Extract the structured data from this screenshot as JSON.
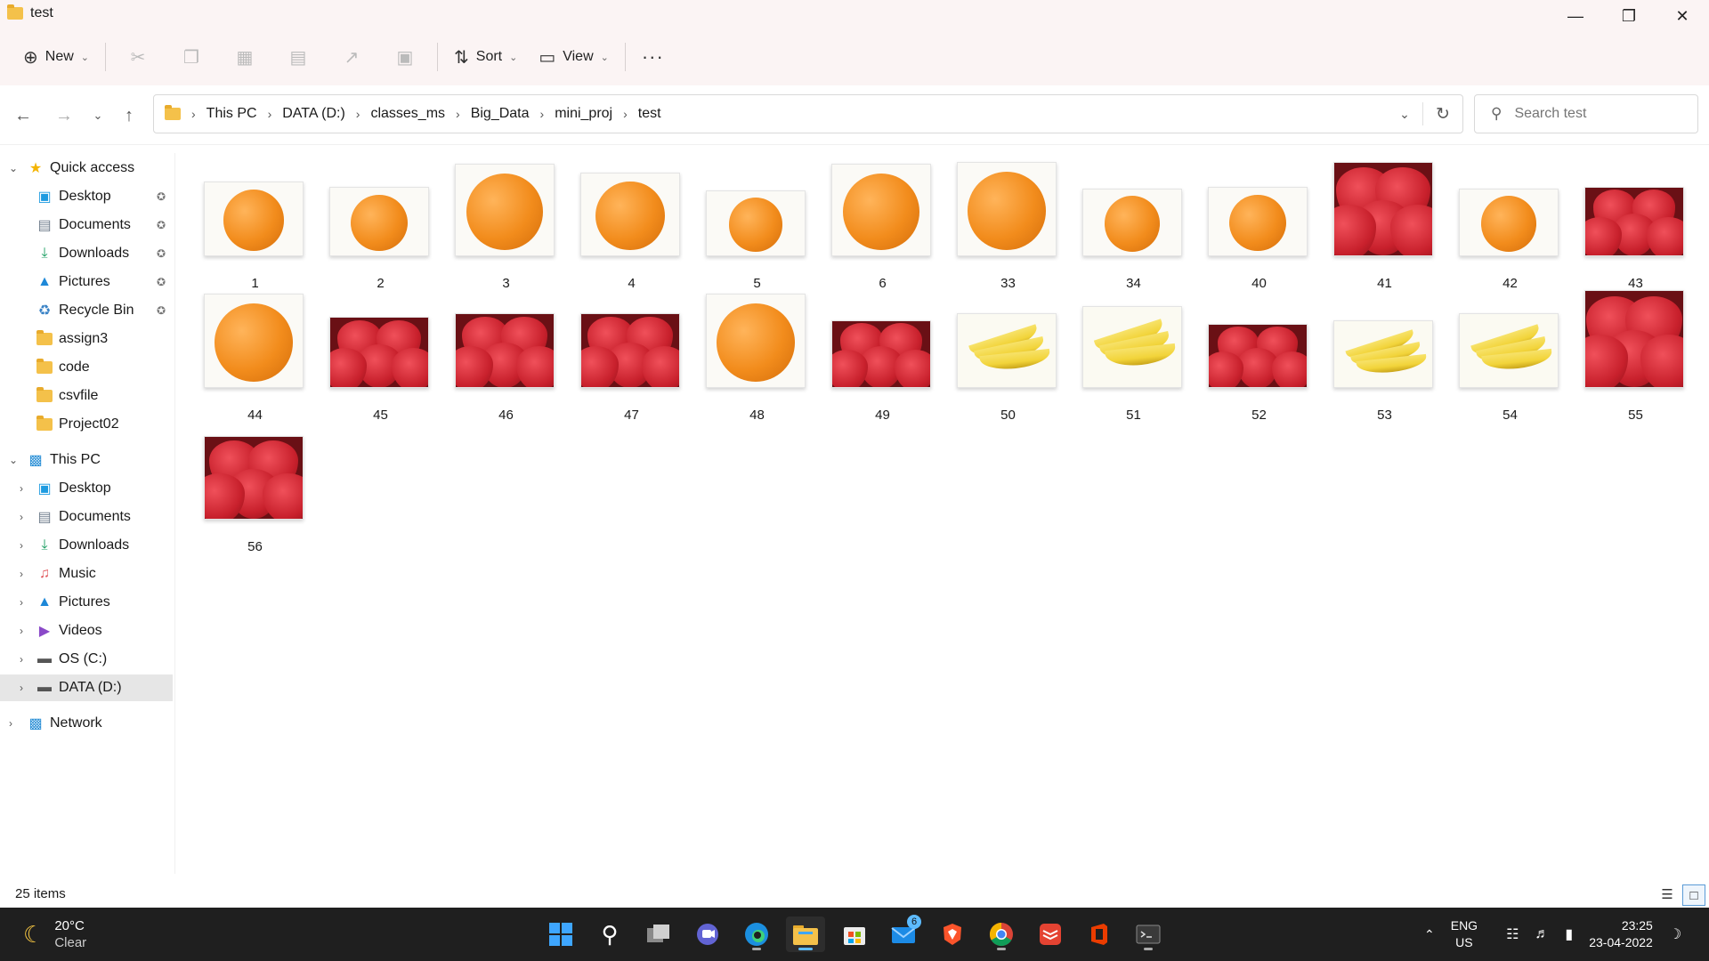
{
  "window": {
    "title": "test"
  },
  "toolbar": {
    "new_label": "New",
    "sort_label": "Sort",
    "view_label": "View"
  },
  "address": {
    "crumbs": [
      "This PC",
      "DATA (D:)",
      "classes_ms",
      "Big_Data",
      "mini_proj",
      "test"
    ]
  },
  "search": {
    "placeholder": "Search test"
  },
  "sidebar": {
    "quick_access": "Quick access",
    "quick_items": [
      "Desktop",
      "Documents",
      "Downloads",
      "Pictures",
      "Recycle Bin",
      "assign3",
      "code",
      "csvfile",
      "Project02"
    ],
    "this_pc": "This PC",
    "pc_items": [
      "Desktop",
      "Documents",
      "Downloads",
      "Music",
      "Pictures",
      "Videos",
      "OS (C:)",
      "DATA (D:)"
    ],
    "network": "Network"
  },
  "files": [
    {
      "name": "1",
      "fruit": "orange"
    },
    {
      "name": "2",
      "fruit": "orange"
    },
    {
      "name": "3",
      "fruit": "orange"
    },
    {
      "name": "4",
      "fruit": "orange"
    },
    {
      "name": "5",
      "fruit": "orange"
    },
    {
      "name": "6",
      "fruit": "orange"
    },
    {
      "name": "33",
      "fruit": "orange"
    },
    {
      "name": "34",
      "fruit": "orange"
    },
    {
      "name": "40",
      "fruit": "orange"
    },
    {
      "name": "41",
      "fruit": "strawberry"
    },
    {
      "name": "42",
      "fruit": "orange"
    },
    {
      "name": "43",
      "fruit": "strawberry"
    },
    {
      "name": "44",
      "fruit": "orange"
    },
    {
      "name": "45",
      "fruit": "strawberry"
    },
    {
      "name": "46",
      "fruit": "strawberry"
    },
    {
      "name": "47",
      "fruit": "strawberry"
    },
    {
      "name": "48",
      "fruit": "orange"
    },
    {
      "name": "49",
      "fruit": "strawberry"
    },
    {
      "name": "50",
      "fruit": "banana"
    },
    {
      "name": "51",
      "fruit": "banana"
    },
    {
      "name": "52",
      "fruit": "strawberry"
    },
    {
      "name": "53",
      "fruit": "banana"
    },
    {
      "name": "54",
      "fruit": "banana"
    },
    {
      "name": "55",
      "fruit": "strawberry"
    },
    {
      "name": "56",
      "fruit": "strawberry"
    }
  ],
  "status": {
    "item_count": "25 items"
  },
  "taskbar": {
    "weather_temp": "20°C",
    "weather_desc": "Clear",
    "mail_badge": "6",
    "lang": "ENG",
    "region": "US",
    "time": "23:25",
    "date": "23-04-2022"
  },
  "colors": {
    "titlebar_bg": "#fbf4f4",
    "taskbar_bg": "#1f1f1f",
    "selection_bg": "#e6e6e6",
    "orange": "#f28c1c",
    "strawberry": "#c8202c",
    "banana": "#f2d43a"
  }
}
